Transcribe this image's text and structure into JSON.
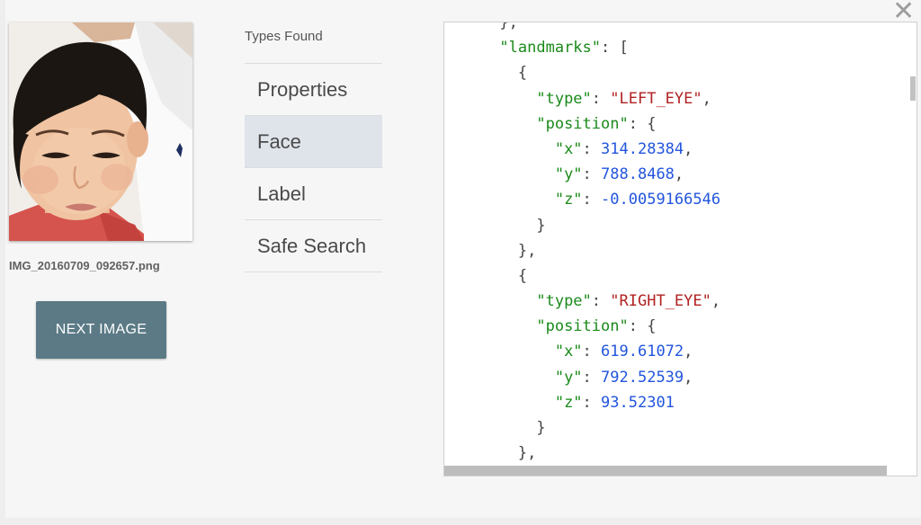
{
  "dialog": {
    "close_label": "✕"
  },
  "image": {
    "filename": "IMG_20160709_092657.png"
  },
  "next_button": {
    "label": "NEXT IMAGE"
  },
  "types": {
    "title": "Types Found",
    "items": [
      {
        "label": "Properties",
        "active": false
      },
      {
        "label": "Face",
        "active": true
      },
      {
        "label": "Label",
        "active": false
      },
      {
        "label": "Safe Search",
        "active": false
      }
    ]
  },
  "json_view": {
    "lines": [
      [
        {
          "c": "p",
          "t": "      },"
        }
      ],
      [
        {
          "c": "p",
          "t": "      "
        },
        {
          "c": "k",
          "t": "\"landmarks\""
        },
        {
          "c": "p",
          "t": ": ["
        }
      ],
      [
        {
          "c": "p",
          "t": "        {"
        }
      ],
      [
        {
          "c": "p",
          "t": "          "
        },
        {
          "c": "k",
          "t": "\"type\""
        },
        {
          "c": "p",
          "t": ": "
        },
        {
          "c": "s",
          "t": "\"LEFT_EYE\""
        },
        {
          "c": "p",
          "t": ","
        }
      ],
      [
        {
          "c": "p",
          "t": "          "
        },
        {
          "c": "k",
          "t": "\"position\""
        },
        {
          "c": "p",
          "t": ": {"
        }
      ],
      [
        {
          "c": "p",
          "t": "            "
        },
        {
          "c": "k",
          "t": "\"x\""
        },
        {
          "c": "p",
          "t": ": "
        },
        {
          "c": "n",
          "t": "314.28384"
        },
        {
          "c": "p",
          "t": ","
        }
      ],
      [
        {
          "c": "p",
          "t": "            "
        },
        {
          "c": "k",
          "t": "\"y\""
        },
        {
          "c": "p",
          "t": ": "
        },
        {
          "c": "n",
          "t": "788.8468"
        },
        {
          "c": "p",
          "t": ","
        }
      ],
      [
        {
          "c": "p",
          "t": "            "
        },
        {
          "c": "k",
          "t": "\"z\""
        },
        {
          "c": "p",
          "t": ": "
        },
        {
          "c": "n",
          "t": "-0.0059166546"
        }
      ],
      [
        {
          "c": "p",
          "t": "          }"
        }
      ],
      [
        {
          "c": "p",
          "t": "        },"
        }
      ],
      [
        {
          "c": "p",
          "t": "        {"
        }
      ],
      [
        {
          "c": "p",
          "t": "          "
        },
        {
          "c": "k",
          "t": "\"type\""
        },
        {
          "c": "p",
          "t": ": "
        },
        {
          "c": "s",
          "t": "\"RIGHT_EYE\""
        },
        {
          "c": "p",
          "t": ","
        }
      ],
      [
        {
          "c": "p",
          "t": "          "
        },
        {
          "c": "k",
          "t": "\"position\""
        },
        {
          "c": "p",
          "t": ": {"
        }
      ],
      [
        {
          "c": "p",
          "t": "            "
        },
        {
          "c": "k",
          "t": "\"x\""
        },
        {
          "c": "p",
          "t": ": "
        },
        {
          "c": "n",
          "t": "619.61072"
        },
        {
          "c": "p",
          "t": ","
        }
      ],
      [
        {
          "c": "p",
          "t": "            "
        },
        {
          "c": "k",
          "t": "\"y\""
        },
        {
          "c": "p",
          "t": ": "
        },
        {
          "c": "n",
          "t": "792.52539"
        },
        {
          "c": "p",
          "t": ","
        }
      ],
      [
        {
          "c": "p",
          "t": "            "
        },
        {
          "c": "k",
          "t": "\"z\""
        },
        {
          "c": "p",
          "t": ": "
        },
        {
          "c": "n",
          "t": "93.52301"
        }
      ],
      [
        {
          "c": "p",
          "t": "          }"
        }
      ],
      [
        {
          "c": "p",
          "t": "        },"
        }
      ]
    ]
  },
  "colors": {
    "button_bg": "#5b7a86",
    "active_item_bg": "#dfe3ea",
    "json_key": "#1a8a1a",
    "json_string": "#b22222",
    "json_number": "#2255dd"
  }
}
